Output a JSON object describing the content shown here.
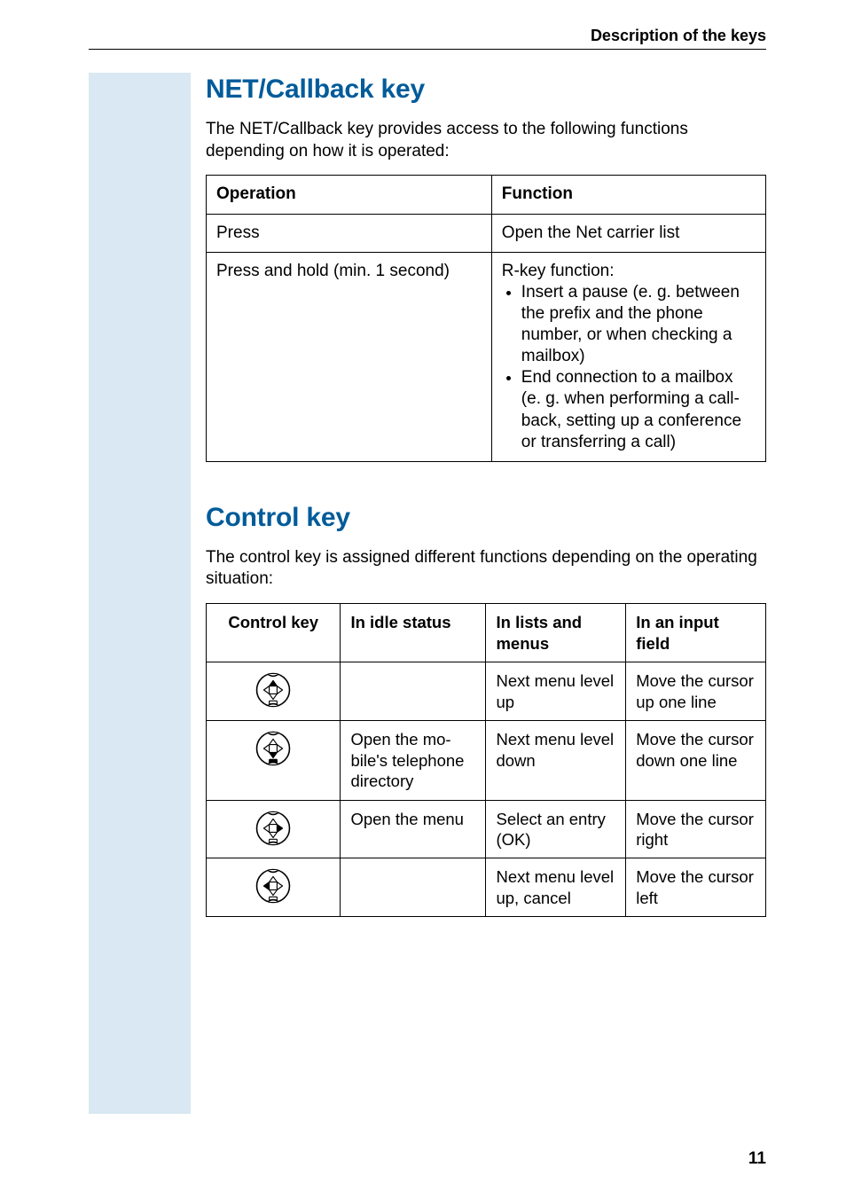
{
  "header": {
    "right": "Description of the keys"
  },
  "section1": {
    "title": "NET/Callback key",
    "intro": "The NET/Callback key provides access to the following functions depending on how it is operated:",
    "table": {
      "head": {
        "operation": "Operation",
        "function": "Function"
      },
      "rows": [
        {
          "op": "Press",
          "fn_text": "Open the Net carrier list",
          "has_list": false
        },
        {
          "op": "Press and hold (min. 1 second)",
          "fn_lead": "R-key function:",
          "fn_items": [
            "Insert a pause (e. g. between the prefix and the phone number, or when checking a mailbox)",
            "End connection to a mailbox (e. g. when performing a call-back, setting up a conference or transferring a call)"
          ],
          "has_list": true
        }
      ]
    }
  },
  "section2": {
    "title": "Control key",
    "intro": "The control key is assigned different functions depending on the operating situation:",
    "table": {
      "head": {
        "c1": "Control key",
        "c2": "In idle status",
        "c3": "In lists and menus",
        "c4": "In an input field"
      },
      "rows": [
        {
          "icon": "up",
          "idle": "",
          "lists": "Next menu level up",
          "input": "Move the cursor up one line"
        },
        {
          "icon": "down",
          "idle": "Open the mo-bile's telephone directory",
          "lists": "Next menu level down",
          "input": "Move the cursor down one line"
        },
        {
          "icon": "right",
          "idle": "Open the menu",
          "lists": "Select an entry (OK)",
          "input": "Move the cursor right"
        },
        {
          "icon": "left",
          "idle": "",
          "lists": "Next menu level up, cancel",
          "input": "Move the cursor left"
        }
      ]
    }
  },
  "page_number": "11"
}
